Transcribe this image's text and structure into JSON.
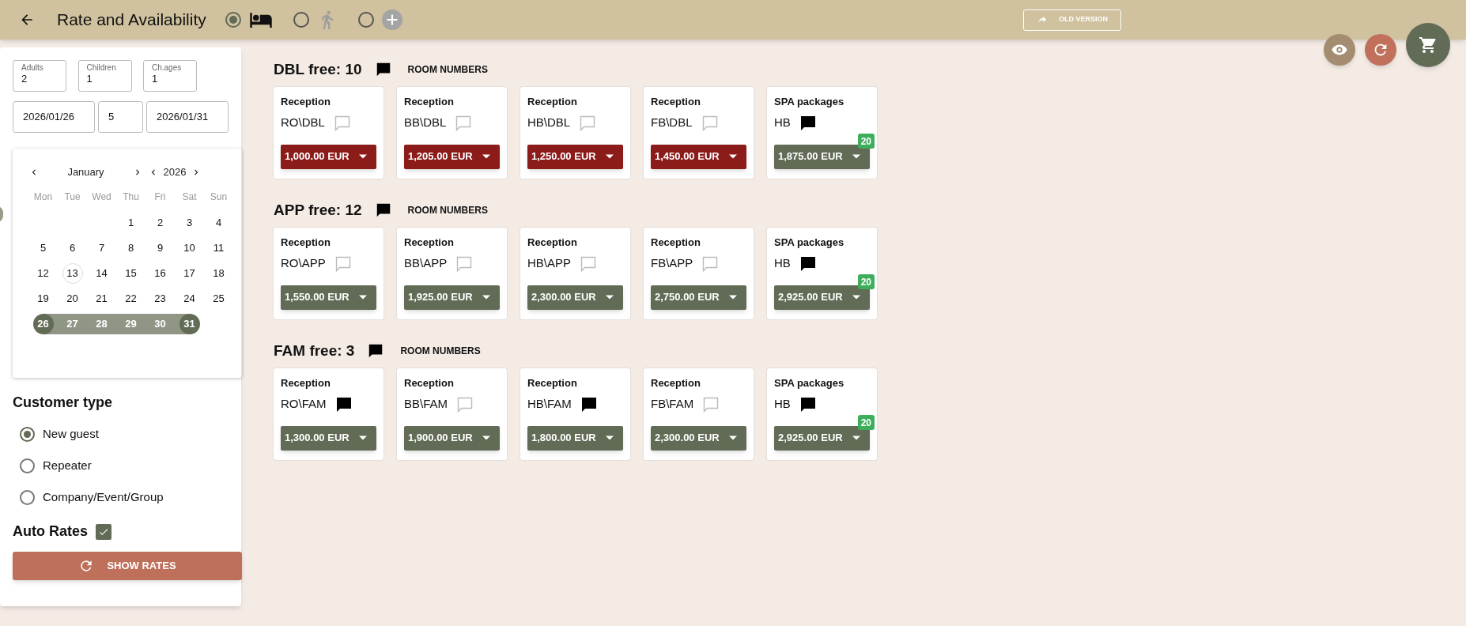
{
  "header": {
    "title": "Rate and Availability",
    "modes": [
      {
        "kind": "bed",
        "selected": true
      },
      {
        "kind": "walk",
        "selected": false
      },
      {
        "kind": "add",
        "selected": false
      }
    ],
    "old_version": "OLD VERSION"
  },
  "search": {
    "adults": {
      "label": "Adults",
      "value": "2"
    },
    "children": {
      "label": "Children",
      "value": "1"
    },
    "child_ages": {
      "label": "Ch.ages",
      "value": "1"
    },
    "arrival": "2026/01/26",
    "nights": "5",
    "departure": "2026/01/31"
  },
  "calendar": {
    "month": "January",
    "year": "2026",
    "weekdays": [
      "Mon",
      "Tue",
      "Wed",
      "Thu",
      "Fri",
      "Sat",
      "Sun"
    ],
    "weeks": [
      [
        {
          "kind": "blank"
        },
        {
          "kind": "blank"
        },
        {
          "kind": "blank"
        },
        {
          "day": "1",
          "kind": "day"
        },
        {
          "day": "2",
          "kind": "day"
        },
        {
          "day": "3",
          "kind": "day"
        },
        {
          "day": "4",
          "kind": "day"
        }
      ],
      [
        {
          "day": "5",
          "kind": "day"
        },
        {
          "day": "6",
          "kind": "day"
        },
        {
          "day": "7",
          "kind": "day"
        },
        {
          "day": "8",
          "kind": "day"
        },
        {
          "day": "9",
          "kind": "day"
        },
        {
          "day": "10",
          "kind": "day"
        },
        {
          "day": "11",
          "kind": "day"
        }
      ],
      [
        {
          "day": "12",
          "kind": "day"
        },
        {
          "day": "13",
          "kind": "today"
        },
        {
          "day": "14",
          "kind": "day"
        },
        {
          "day": "15",
          "kind": "day"
        },
        {
          "day": "16",
          "kind": "day"
        },
        {
          "day": "17",
          "kind": "day"
        },
        {
          "day": "18",
          "kind": "day"
        }
      ],
      [
        {
          "day": "19",
          "kind": "day"
        },
        {
          "day": "20",
          "kind": "day"
        },
        {
          "day": "21",
          "kind": "day"
        },
        {
          "day": "22",
          "kind": "day"
        },
        {
          "day": "23",
          "kind": "day"
        },
        {
          "day": "24",
          "kind": "day"
        },
        {
          "day": "25",
          "kind": "day"
        }
      ],
      [
        {
          "day": "26",
          "kind": "start"
        },
        {
          "day": "27",
          "kind": "between"
        },
        {
          "day": "28",
          "kind": "between"
        },
        {
          "day": "29",
          "kind": "between"
        },
        {
          "day": "30",
          "kind": "between"
        },
        {
          "day": "31",
          "kind": "end"
        },
        {
          "kind": "blank"
        }
      ]
    ]
  },
  "customer_type": {
    "title": "Customer type",
    "options": [
      {
        "label": "New guest",
        "selected": true
      },
      {
        "label": "Repeater",
        "selected": false
      },
      {
        "label": "Company/Event/Group",
        "selected": false
      }
    ]
  },
  "auto_rates": {
    "label": "Auto Rates",
    "checked": true
  },
  "show_rates": "SHOW RATES",
  "rooms": [
    {
      "title": "DBL free: 10",
      "has_note": true,
      "room_numbers": "ROOM NUMBERS",
      "rates": [
        {
          "group": "Reception",
          "name": "RO\\DBL",
          "has_note": false,
          "price": "1,000.00 EUR",
          "color": "#8b1c1a"
        },
        {
          "group": "Reception",
          "name": "BB\\DBL",
          "has_note": false,
          "price": "1,205.00 EUR",
          "color": "#8b1c1a"
        },
        {
          "group": "Reception",
          "name": "HB\\DBL",
          "has_note": false,
          "price": "1,250.00 EUR",
          "color": "#8b1c1a"
        },
        {
          "group": "Reception",
          "name": "FB\\DBL",
          "has_note": false,
          "price": "1,450.00 EUR",
          "color": "#8b1c1a"
        },
        {
          "group": "SPA packages",
          "name": "HB",
          "has_note": true,
          "price": "1,875.00 EUR",
          "color": "#616b55",
          "badge": "20"
        }
      ]
    },
    {
      "title": "APP free: 12",
      "has_note": true,
      "room_numbers": "ROOM NUMBERS",
      "rates": [
        {
          "group": "Reception",
          "name": "RO\\APP",
          "has_note": false,
          "price": "1,550.00 EUR",
          "color": "#616b55"
        },
        {
          "group": "Reception",
          "name": "BB\\APP",
          "has_note": false,
          "price": "1,925.00 EUR",
          "color": "#616b55"
        },
        {
          "group": "Reception",
          "name": "HB\\APP",
          "has_note": false,
          "price": "2,300.00 EUR",
          "color": "#616b55"
        },
        {
          "group": "Reception",
          "name": "FB\\APP",
          "has_note": false,
          "price": "2,750.00 EUR",
          "color": "#616b55"
        },
        {
          "group": "SPA packages",
          "name": "HB",
          "has_note": true,
          "price": "2,925.00 EUR",
          "color": "#616b55",
          "badge": "20"
        }
      ]
    },
    {
      "title": "FAM free: 3",
      "has_note": true,
      "room_numbers": "ROOM NUMBERS",
      "rates": [
        {
          "group": "Reception",
          "name": "RO\\FAM",
          "has_note": true,
          "price": "1,300.00 EUR",
          "color": "#616b55"
        },
        {
          "group": "Reception",
          "name": "BB\\FAM",
          "has_note": false,
          "price": "1,900.00 EUR",
          "color": "#616b55"
        },
        {
          "group": "Reception",
          "name": "HB\\FAM",
          "has_note": true,
          "price": "1,800.00 EUR",
          "color": "#616b55"
        },
        {
          "group": "Reception",
          "name": "FB\\FAM",
          "has_note": false,
          "price": "2,300.00 EUR",
          "color": "#616b55"
        },
        {
          "group": "SPA packages",
          "name": "HB",
          "has_note": true,
          "price": "2,925.00 EUR",
          "color": "#616b55",
          "badge": "20"
        }
      ]
    }
  ]
}
